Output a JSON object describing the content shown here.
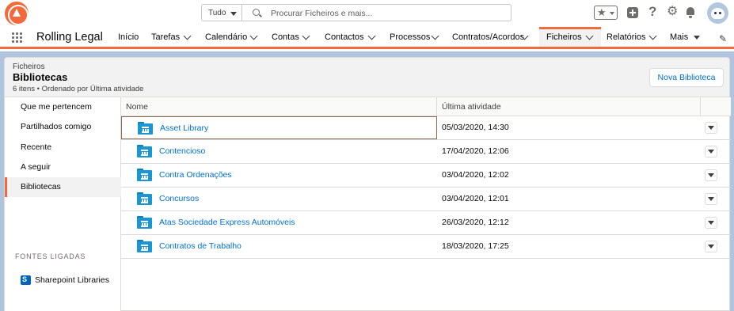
{
  "header": {
    "logo_icon": "org-logo-icon",
    "search": {
      "scope": "Tudo",
      "placeholder": "Procurar Ficheiros e mais..."
    },
    "icons": [
      "favorites-star-icon",
      "global-add-icon",
      "help-icon",
      "setup-gear-icon",
      "notifications-bell-icon",
      "user-avatar"
    ]
  },
  "nav": {
    "app_name": "Rolling Legal",
    "items": [
      {
        "label": "Início"
      },
      {
        "label": "Tarefas"
      },
      {
        "label": "Calendário"
      },
      {
        "label": "Contas"
      },
      {
        "label": "Contactos"
      },
      {
        "label": "Processos"
      },
      {
        "label": "Contratos/Acordos"
      },
      {
        "label": "Ficheiros",
        "active": true
      },
      {
        "label": "Relatórios"
      },
      {
        "label": "Mais"
      }
    ]
  },
  "page_header": {
    "eyebrow": "Ficheiros",
    "title": "Bibliotecas",
    "meta": "6 itens • Ordenado por Última atividade",
    "new_button": "Nova Biblioteca"
  },
  "sidebar": {
    "items": [
      {
        "label": "Que me pertencem"
      },
      {
        "label": "Partilhados comigo"
      },
      {
        "label": "Recente"
      },
      {
        "label": "A seguir"
      },
      {
        "label": "Bibliotecas",
        "active": true
      }
    ],
    "section_title": "FONTES LIGADAS",
    "connected": [
      {
        "label": "Sharepoint Libraries",
        "icon": "sharepoint-icon"
      }
    ]
  },
  "table": {
    "columns": {
      "name": "Nome",
      "activity": "Última atividade"
    },
    "rows": [
      {
        "name": "Asset Library",
        "date": "05/03/2020, 14:30"
      },
      {
        "name": "Contencioso",
        "date": "17/04/2020, 12:06"
      },
      {
        "name": "Contra Ordenações",
        "date": "03/04/2020, 12:02"
      },
      {
        "name": "Concursos",
        "date": "03/04/2020, 12:01"
      },
      {
        "name": "Atas Sociedade Express Automóveis",
        "date": "26/03/2020, 12:12"
      },
      {
        "name": "Contratos de Trabalho",
        "date": "18/03/2020, 17:25"
      }
    ]
  },
  "colors": {
    "brand_orange": "#f26a3b",
    "link_blue": "#0070d2",
    "folder_blue": "#1a96d4",
    "background_blue": "#b0c4df"
  }
}
